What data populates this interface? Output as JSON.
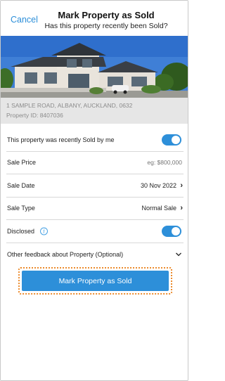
{
  "header": {
    "cancel_label": "Cancel",
    "title": "Mark Property as Sold",
    "subtitle": "Has this property recently been Sold?"
  },
  "property": {
    "photo": "house-photo",
    "address": "1 SAMPLE ROAD, ALBANY, AUCKLAND, 0632",
    "property_id": "Property ID: 8407036"
  },
  "form": {
    "sold_by_me": {
      "label": "This property was recently Sold by me",
      "on": true
    },
    "sale_price": {
      "label": "Sale Price",
      "placeholder": "eg: $800,000"
    },
    "sale_date": {
      "label": "Sale Date",
      "value": "30 Nov 2022"
    },
    "sale_type": {
      "label": "Sale Type",
      "value": "Normal Sale"
    },
    "disclosed": {
      "label": "Disclosed",
      "on": true
    },
    "feedback": {
      "label": "Other feedback about Property (Optional)"
    }
  },
  "submit_label": "Mark Property as Sold",
  "colors": {
    "accent": "#2d8fd9",
    "highlight": "#ec8b2c",
    "strip": "#e6e6e6"
  }
}
